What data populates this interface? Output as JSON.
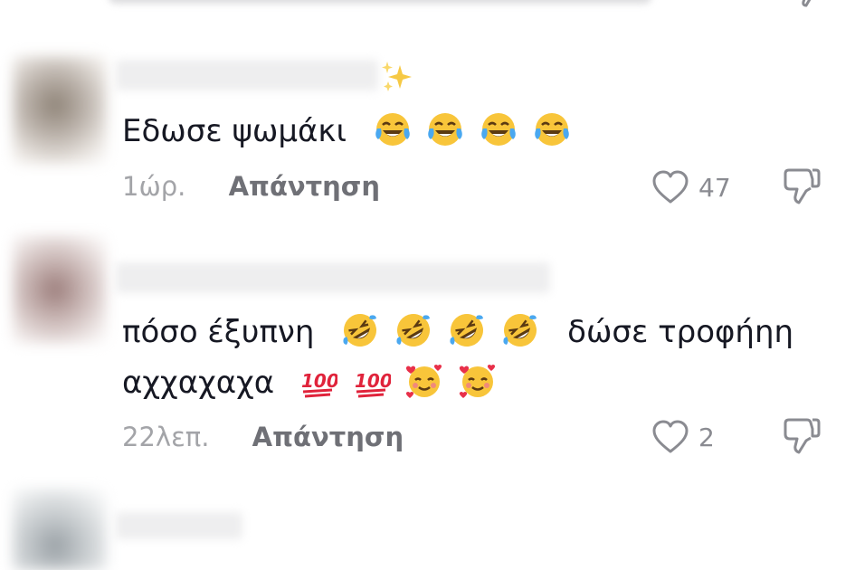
{
  "comments": [
    {
      "text_lines": [
        "Εδωσε ψωμάκι"
      ],
      "time": "1ώρ.",
      "reply_label": "Απάντηση",
      "likes": "47",
      "badge_icon": "sparkles-icon",
      "emoji_icons": [
        "tears-of-joy-icon",
        "tears-of-joy-icon",
        "tears-of-joy-icon",
        "tears-of-joy-icon"
      ]
    },
    {
      "text_lines": [
        "πόσο έξυπνη",
        "δώσε τροφήηη",
        "αχχαχαχα"
      ],
      "time": "22λεπ.",
      "reply_label": "Απάντηση",
      "likes": "2",
      "emoji_icons_line1": [
        "rolling-on-floor-laughing-icon",
        "rolling-on-floor-laughing-icon",
        "rolling-on-floor-laughing-icon",
        "rolling-on-floor-laughing-icon"
      ],
      "emoji_icons_line2": [
        "hundred-points-icon",
        "hundred-points-icon",
        "smiling-face-with-hearts-icon",
        "smiling-face-with-hearts-icon"
      ]
    }
  ],
  "colors": {
    "text": "#161823",
    "meta_time": "#a3a4a8",
    "meta_reply": "#6f7076",
    "icon": "#8a8b91"
  }
}
